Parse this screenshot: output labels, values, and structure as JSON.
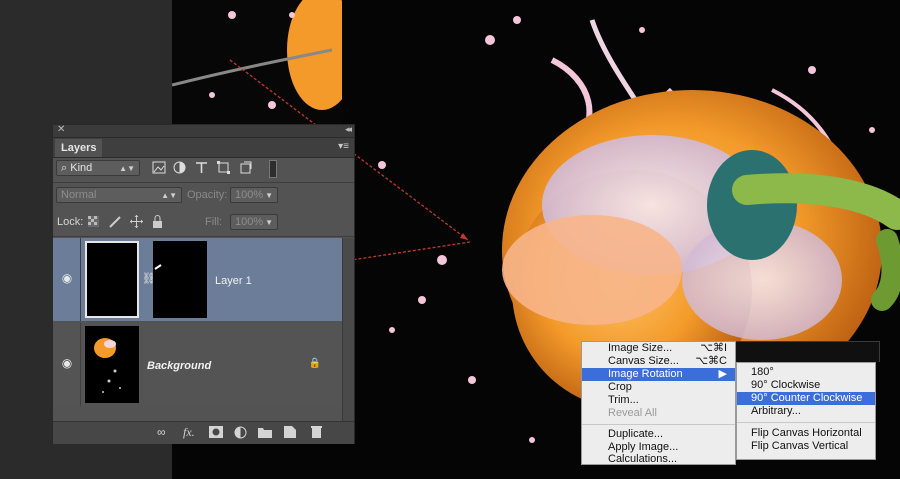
{
  "layers_panel": {
    "close_glyph": "✕",
    "collapse_glyph": "◂◂",
    "tab_label": "Layers",
    "menu_glyph": "▾≡",
    "filter_kind": "Kind",
    "search_glyph": "⌕",
    "blend_mode": "Normal",
    "opacity_label": "Opacity:",
    "opacity_value": "100%",
    "lock_label": "Lock:",
    "fill_label": "Fill:",
    "fill_value": "100%",
    "eye_glyph": "◉",
    "chain_glyph": "⛓",
    "lock_glyph": "🔒",
    "layers": [
      {
        "name": "Layer 1",
        "selected": true
      },
      {
        "name": "Background",
        "selected": false
      }
    ]
  },
  "image_menu": {
    "items": [
      {
        "label": "Image Size...",
        "shortcut": "⌥⌘I"
      },
      {
        "label": "Canvas Size...",
        "shortcut": "⌥⌘C"
      },
      {
        "label": "Image Rotation",
        "arrow": "▶",
        "highlight": true
      },
      {
        "label": "Crop"
      },
      {
        "label": "Trim..."
      },
      {
        "label": "Reveal All",
        "disabled": true
      },
      {
        "label": "Duplicate..."
      },
      {
        "label": "Apply Image..."
      },
      {
        "label": "Calculations..."
      }
    ]
  },
  "rotation_submenu": {
    "items": [
      {
        "label": "180°"
      },
      {
        "label": "90° Clockwise"
      },
      {
        "label": "90° Counter Clockwise",
        "highlight": true
      },
      {
        "label": "Arbitrary..."
      },
      {
        "label": "Flip Canvas Horizontal"
      },
      {
        "label": "Flip Canvas Vertical"
      }
    ]
  },
  "colors": {
    "selection_blue": "#3b6ed8",
    "selected_layer": "#6b7d99",
    "panel_gray": "#535353",
    "arrow_red": "#c0392b",
    "pepper_orange": "#f39a2a"
  },
  "icons": [
    "image-filter-icon",
    "adjustment-filter-icon",
    "type-filter-icon",
    "shape-filter-icon",
    "smart-object-filter-icon",
    "filter-toggle-icon",
    "lock-transparent-icon",
    "lock-image-icon",
    "lock-position-icon",
    "lock-all-icon",
    "link-layers-icon",
    "fx-icon",
    "add-mask-icon",
    "new-adjustment-icon",
    "new-group-icon",
    "new-layer-icon",
    "delete-layer-icon"
  ]
}
